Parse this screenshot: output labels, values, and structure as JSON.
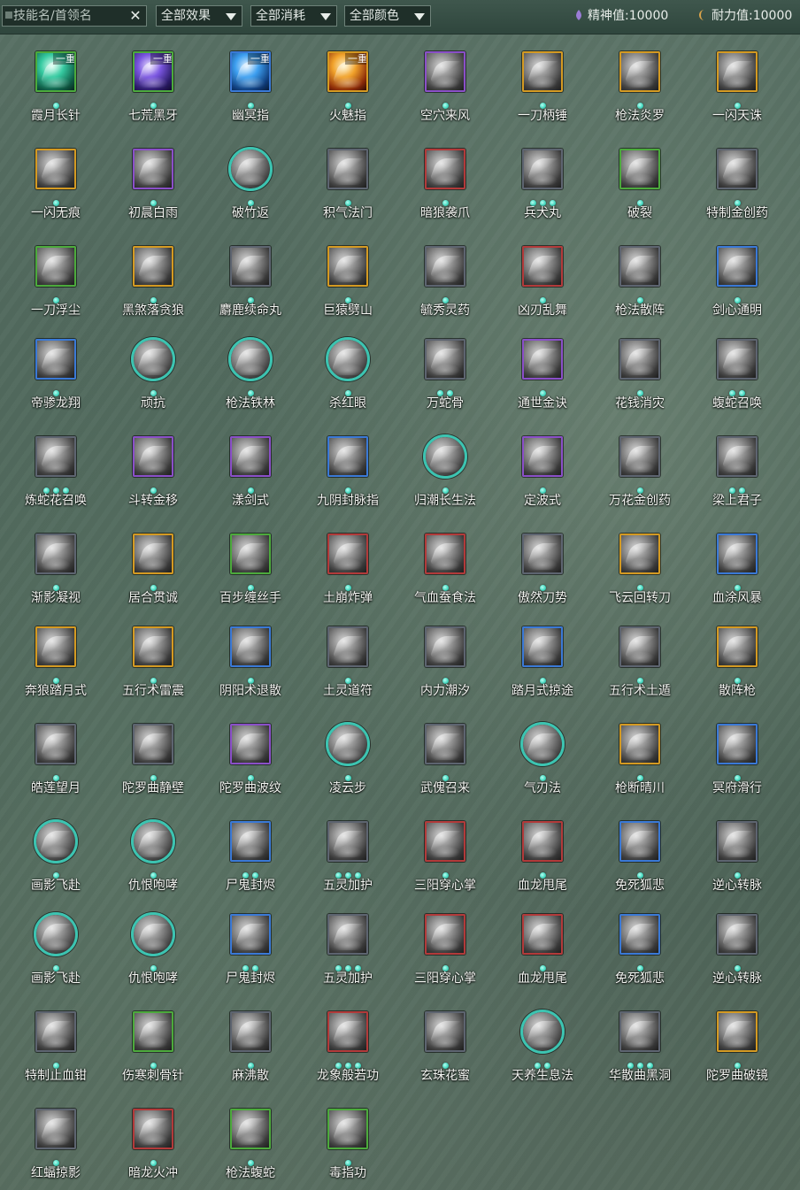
{
  "search": {
    "placeholder": "技能名/首领名",
    "clear_icon": "close-icon"
  },
  "filters": [
    {
      "label": "全部效果"
    },
    {
      "label": "全部消耗"
    },
    {
      "label": "全部颜色"
    }
  ],
  "stats": [
    {
      "label": "精神值:10000",
      "icon": "spirit-icon",
      "color": "#9b7cd6"
    },
    {
      "label": "耐力值:10000",
      "icon": "stamina-icon",
      "color": "#d9a34a"
    }
  ],
  "tier_colors": {
    "green": "#4caa3c",
    "purple": "#8a4fc8",
    "blue": "#3a79d6",
    "orange": "#d49a22",
    "gray": "#5d6470",
    "red": "#b23a3a",
    "teal": "#3cc4b1"
  },
  "skills": [
    {
      "name": "霞月长针",
      "tier": "green",
      "tag": "一重",
      "dots": 1,
      "art": "teal"
    },
    {
      "name": "七荒黑牙",
      "tier": "green",
      "tag": "一重",
      "dots": 1,
      "art": "violet"
    },
    {
      "name": "幽冥指",
      "tier": "blue",
      "tag": "一重",
      "dots": 1,
      "art": "azure"
    },
    {
      "name": "火魅指",
      "tier": "orange",
      "tag": "一重",
      "dots": 1,
      "art": "fire"
    },
    {
      "name": "空穴来风",
      "tier": "purple",
      "dots": 1
    },
    {
      "name": "一刀柄锤",
      "tier": "orange",
      "dots": 1
    },
    {
      "name": "枪法炎罗",
      "tier": "orange",
      "dots": 1
    },
    {
      "name": "一闪天诛",
      "tier": "orange",
      "dots": 1
    },
    {
      "name": "一闪无痕",
      "tier": "orange",
      "dots": 1
    },
    {
      "name": "初晨白雨",
      "tier": "purple",
      "dots": 1
    },
    {
      "name": "破竹返",
      "tier": "teal",
      "shape": "round",
      "dots": 1
    },
    {
      "name": "积气法门",
      "tier": "gray",
      "dots": 1
    },
    {
      "name": "暗狼袭爪",
      "tier": "red",
      "dots": 1
    },
    {
      "name": "兵犬丸",
      "tier": "gray",
      "dots": 3
    },
    {
      "name": "破裂",
      "tier": "green",
      "dots": 1
    },
    {
      "name": "特制金创药",
      "tier": "gray",
      "dots": 1
    },
    {
      "name": "一刀浮尘",
      "tier": "green",
      "dots": 1
    },
    {
      "name": "黑煞落贪狼",
      "tier": "orange",
      "dots": 1
    },
    {
      "name": "麝鹿续命丸",
      "tier": "gray",
      "dots": 1
    },
    {
      "name": "巨猿劈山",
      "tier": "orange",
      "dots": 1
    },
    {
      "name": "毓秀灵药",
      "tier": "gray",
      "dots": 1
    },
    {
      "name": "凶刃乱舞",
      "tier": "red",
      "dots": 1
    },
    {
      "name": "枪法散阵",
      "tier": "gray",
      "dots": 1
    },
    {
      "name": "剑心通明",
      "tier": "blue",
      "dots": 1
    },
    {
      "name": "帝骖龙翔",
      "tier": "blue",
      "dots": 1
    },
    {
      "name": "顽抗",
      "tier": "teal",
      "shape": "round",
      "dots": 1
    },
    {
      "name": "枪法铁林",
      "tier": "teal",
      "shape": "round",
      "dots": 1
    },
    {
      "name": "杀红眼",
      "tier": "teal",
      "shape": "round",
      "dots": 1
    },
    {
      "name": "万蛇骨",
      "tier": "gray",
      "dots": 2
    },
    {
      "name": "通世金诀",
      "tier": "purple",
      "dots": 1
    },
    {
      "name": "花钱消灾",
      "tier": "gray",
      "dots": 1
    },
    {
      "name": "蝮蛇召唤",
      "tier": "gray",
      "dots": 2
    },
    {
      "name": "炼蛇花召唤",
      "tier": "gray",
      "dots": 3
    },
    {
      "name": "斗转金移",
      "tier": "purple",
      "dots": 1
    },
    {
      "name": "漾剑式",
      "tier": "purple",
      "dots": 1
    },
    {
      "name": "九阴封脉指",
      "tier": "blue",
      "dots": 1
    },
    {
      "name": "归潮长生法",
      "tier": "teal",
      "shape": "round",
      "dots": 1
    },
    {
      "name": "定波式",
      "tier": "purple",
      "dots": 1
    },
    {
      "name": "万花金创药",
      "tier": "gray",
      "dots": 1
    },
    {
      "name": "梁上君子",
      "tier": "gray",
      "dots": 2
    },
    {
      "name": "渐影凝视",
      "tier": "gray",
      "dots": 1
    },
    {
      "name": "居合贯诚",
      "tier": "orange",
      "dots": 1
    },
    {
      "name": "百步缠丝手",
      "tier": "green",
      "dots": 1
    },
    {
      "name": "土崩炸弹",
      "tier": "red",
      "dots": 1
    },
    {
      "name": "气血蚕食法",
      "tier": "red",
      "dots": 1
    },
    {
      "name": "傲然刀势",
      "tier": "gray",
      "dots": 1
    },
    {
      "name": "飞云回转刀",
      "tier": "orange",
      "dots": 1
    },
    {
      "name": "血涂风暴",
      "tier": "blue",
      "dots": 1
    },
    {
      "name": "奔狼踏月式",
      "tier": "orange",
      "dots": 1
    },
    {
      "name": "五行术雷震",
      "tier": "orange",
      "dots": 1
    },
    {
      "name": "阴阳术退散",
      "tier": "blue",
      "dots": 1
    },
    {
      "name": "土灵道符",
      "tier": "gray",
      "dots": 1
    },
    {
      "name": "内力潮汐",
      "tier": "gray",
      "dots": 1
    },
    {
      "name": "踏月式掠途",
      "tier": "blue",
      "dots": 1
    },
    {
      "name": "五行术土遁",
      "tier": "gray",
      "dots": 1
    },
    {
      "name": "散阵枪",
      "tier": "orange",
      "dots": 1
    },
    {
      "name": "皓莲望月",
      "tier": "gray",
      "dots": 1
    },
    {
      "name": "陀罗曲静壁",
      "tier": "gray",
      "dots": 1
    },
    {
      "name": "陀罗曲波纹",
      "tier": "purple",
      "dots": 1
    },
    {
      "name": "凌云步",
      "tier": "teal",
      "shape": "round",
      "dots": 1
    },
    {
      "name": "武傀召来",
      "tier": "gray",
      "dots": 1
    },
    {
      "name": "气刃法",
      "tier": "teal",
      "shape": "round",
      "dots": 1
    },
    {
      "name": "枪断晴川",
      "tier": "orange",
      "dots": 1
    },
    {
      "name": "冥府滑行",
      "tier": "blue",
      "dots": 1
    },
    {
      "name": "画影飞赴",
      "tier": "teal",
      "shape": "round",
      "dots": 1
    },
    {
      "name": "仇恨咆哮",
      "tier": "teal",
      "shape": "round",
      "dots": 1
    },
    {
      "name": "尸鬼封烬",
      "tier": "blue",
      "dots": 2
    },
    {
      "name": "五灵加护",
      "tier": "gray",
      "dots": 3
    },
    {
      "name": "三阳穿心掌",
      "tier": "red",
      "dots": 1
    },
    {
      "name": "血龙甩尾",
      "tier": "red",
      "dots": 1
    },
    {
      "name": "免死狐悲",
      "tier": "blue",
      "dots": 1
    },
    {
      "name": "逆心转脉",
      "tier": "gray",
      "dots": 1
    },
    {
      "name": "画影飞赴",
      "tier": "teal",
      "shape": "round",
      "dots": 1
    },
    {
      "name": "仇恨咆哮",
      "tier": "teal",
      "shape": "round",
      "dots": 1
    },
    {
      "name": "尸鬼封烬",
      "tier": "blue",
      "dots": 2
    },
    {
      "name": "五灵加护",
      "tier": "gray",
      "dots": 3
    },
    {
      "name": "三阳穿心掌",
      "tier": "red",
      "dots": 1
    },
    {
      "name": "血龙甩尾",
      "tier": "red",
      "dots": 1
    },
    {
      "name": "免死狐悲",
      "tier": "blue",
      "dots": 1
    },
    {
      "name": "逆心转脉",
      "tier": "gray",
      "dots": 1
    },
    {
      "name": "特制止血钳",
      "tier": "gray",
      "dots": 1
    },
    {
      "name": "伤寒刺骨针",
      "tier": "green",
      "dots": 1
    },
    {
      "name": "麻沸散",
      "tier": "gray",
      "dots": 1
    },
    {
      "name": "龙象般若功",
      "tier": "red",
      "dots": 3
    },
    {
      "name": "玄珠花蜜",
      "tier": "gray",
      "dots": 1
    },
    {
      "name": "天养生息法",
      "tier": "teal",
      "shape": "round",
      "dots": 2
    },
    {
      "name": "华散曲黑洞",
      "tier": "gray",
      "dots": 3
    },
    {
      "name": "陀罗曲破镜",
      "tier": "orange",
      "dots": 1
    },
    {
      "name": "红蝠掠影",
      "tier": "gray",
      "dots": 1
    },
    {
      "name": "暗龙火冲",
      "tier": "red",
      "dots": 1
    },
    {
      "name": "枪法蝮蛇",
      "tier": "green",
      "dots": 1
    },
    {
      "name": "毒指功",
      "tier": "green",
      "dots": 1
    }
  ]
}
